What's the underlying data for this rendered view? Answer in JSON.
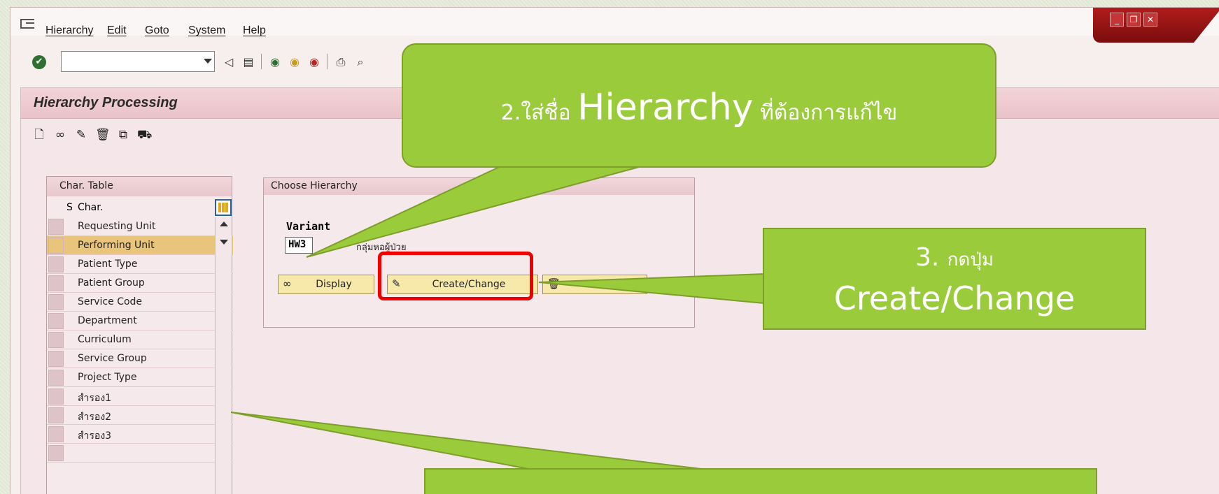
{
  "menubar": {
    "items": [
      "Hierarchy",
      "Edit",
      "Goto",
      "System",
      "Help"
    ]
  },
  "toolbar": {
    "command_field_value": "",
    "icons": [
      "ok-icon",
      "back-icon",
      "save-icon",
      "green-nav-icon",
      "exit-icon",
      "cancel-icon",
      "print-icon",
      "find-icon"
    ]
  },
  "panel": {
    "title": "Hierarchy Processing",
    "app_icons": [
      "new-icon",
      "display-icon",
      "change-icon",
      "delete-icon",
      "copy-icon",
      "transport-icon"
    ]
  },
  "char_table": {
    "title": "Char. Table",
    "col_s": "S",
    "col_char": "Char.",
    "rows": [
      {
        "label": "Requesting Unit",
        "selected": false
      },
      {
        "label": "Performing Unit",
        "selected": true
      },
      {
        "label": "Patient Type",
        "selected": false
      },
      {
        "label": "Patient Group",
        "selected": false
      },
      {
        "label": "Service Code",
        "selected": false
      },
      {
        "label": "Department",
        "selected": false
      },
      {
        "label": "Curriculum",
        "selected": false
      },
      {
        "label": "Service Group",
        "selected": false
      },
      {
        "label": "Project Type",
        "selected": false
      },
      {
        "label": "สำรอง1",
        "selected": false
      },
      {
        "label": "สำรอง2",
        "selected": false
      },
      {
        "label": "สำรอง3",
        "selected": false
      },
      {
        "label": "",
        "selected": false
      }
    ]
  },
  "choose_hierarchy": {
    "title": "Choose Hierarchy",
    "variant_label": "Variant",
    "variant_value": "HW3",
    "variant_desc": "กลุ่มหอผู้ป่วย",
    "buttons": {
      "display": "Display",
      "create_change": "Create/Change",
      "delete": "Delete"
    }
  },
  "callouts": {
    "c1": {
      "num": "2.",
      "pre": "ใส่ชื่อ ",
      "big": "Hierarchy",
      "post": " ที่ต้องการแก้ไข"
    },
    "c2": {
      "line1_num": "3. ",
      "line1_text": "กดปุ่ม",
      "line2": "Create/Change"
    }
  },
  "colors": {
    "callout_green": "#9acb3a",
    "highlight_red": "#ee0000",
    "selected_row": "#e9c57c"
  }
}
